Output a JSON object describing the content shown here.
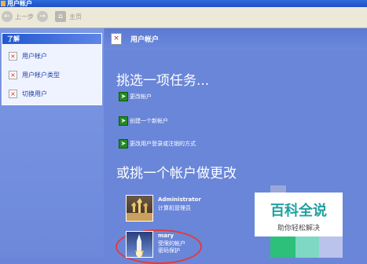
{
  "window": {
    "title": "用户帐户"
  },
  "toolbar": {
    "back_label": "上一步",
    "home_label": "主页"
  },
  "sidebar": {
    "panel_title": "了解",
    "items": [
      {
        "label": "用户帐户"
      },
      {
        "label": "用户帐户类型"
      },
      {
        "label": "切换用户"
      }
    ]
  },
  "main": {
    "header_title": "用户帐户",
    "pick_task_heading": "挑选一项任务...",
    "tasks": [
      {
        "label": "更改帐户"
      },
      {
        "label": "创建一个新帐户"
      },
      {
        "label": "更改用户登录或注销的方式"
      }
    ],
    "pick_account_heading": "或挑一个帐户做更改",
    "accounts": [
      {
        "name": "Administrator",
        "description": "计算机管理员"
      },
      {
        "name": "mary",
        "description": "受限的帐户",
        "extra": "密码保护"
      }
    ]
  },
  "watermark": {
    "title": "百科全说",
    "subtitle": "助你轻松解决"
  },
  "colors": {
    "accent": "#2258d0",
    "task_arrow": "#238a23",
    "highlight_circle": "#e33b3b",
    "watermark_text": "#21a0a0"
  }
}
